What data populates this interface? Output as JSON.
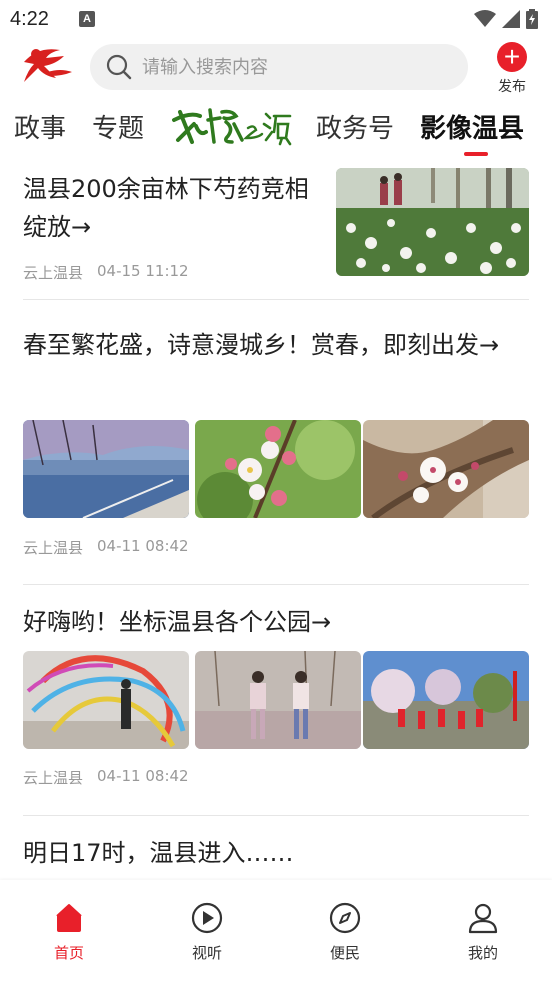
{
  "status": {
    "time": "4:22",
    "a_label": "A"
  },
  "header": {
    "search_placeholder": "请输入搜索内容",
    "publish_label": "发布"
  },
  "tabs": [
    {
      "label": "政事"
    },
    {
      "label": "专题"
    },
    {
      "label": "政务号"
    },
    {
      "label": "影像温县",
      "active": true
    }
  ],
  "articles": [
    {
      "title": "温县200余亩林下芍药竞相绽放→",
      "source": "云上温县",
      "time": "04-15 11:12"
    },
    {
      "title": "春至繁花盛，诗意漫城乡！赏春，即刻出发→",
      "source": "云上温县",
      "time": "04-11 08:42"
    },
    {
      "title": "好嗨哟！坐标温县各个公园→",
      "source": "云上温县",
      "time": "04-11 08:42"
    },
    {
      "title": "明日17时，温县进入……"
    }
  ],
  "bottom_nav": [
    {
      "label": "首页",
      "icon": "home-icon",
      "active": true
    },
    {
      "label": "视听",
      "icon": "play-icon"
    },
    {
      "label": "便民",
      "icon": "compass-icon"
    },
    {
      "label": "我的",
      "icon": "user-icon"
    }
  ],
  "colors": {
    "accent": "#e8202a",
    "brand_green": "#2f7a1e"
  }
}
